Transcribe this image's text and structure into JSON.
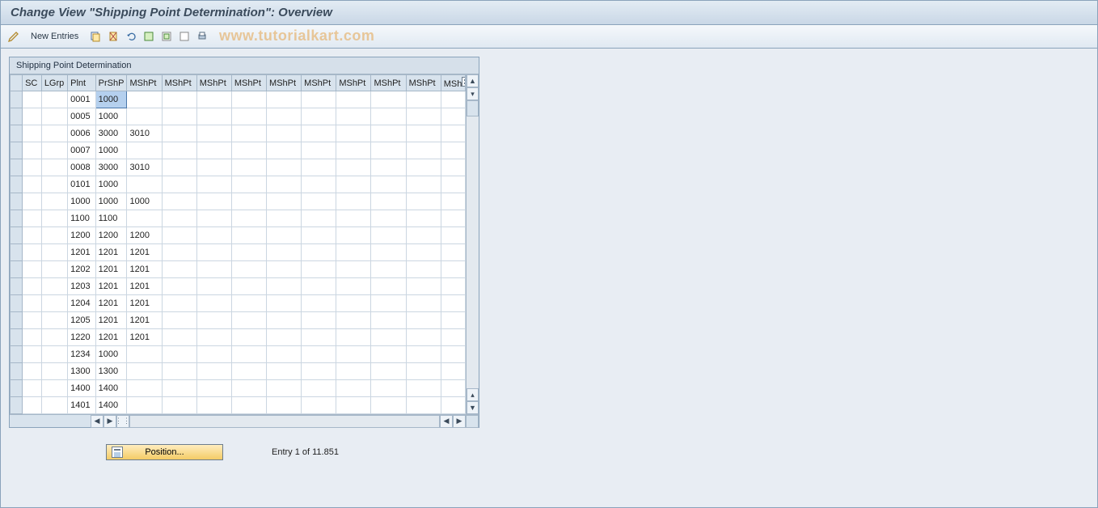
{
  "page_title": "Change View \"Shipping Point Determination\": Overview",
  "toolbar": {
    "new_entries_label": "New Entries"
  },
  "watermark": "www.tutorialkart.com",
  "panel": {
    "title": "Shipping Point Determination"
  },
  "columns": {
    "sc": "SC",
    "lgrp": "LGrp",
    "plnt": "Plnt",
    "prshp": "PrShP",
    "mshpt": "MShPt",
    "mshpt_last": "MSh"
  },
  "rows": [
    {
      "sc": "",
      "lgrp": "",
      "plnt": "0001",
      "prshp": "1000",
      "m": [
        "",
        "",
        "",
        "",
        "",
        "",
        "",
        "",
        "",
        ""
      ]
    },
    {
      "sc": "",
      "lgrp": "",
      "plnt": "0005",
      "prshp": "1000",
      "m": [
        "",
        "",
        "",
        "",
        "",
        "",
        "",
        "",
        "",
        ""
      ]
    },
    {
      "sc": "",
      "lgrp": "",
      "plnt": "0006",
      "prshp": "3000",
      "m": [
        "3010",
        "",
        "",
        "",
        "",
        "",
        "",
        "",
        "",
        ""
      ]
    },
    {
      "sc": "",
      "lgrp": "",
      "plnt": "0007",
      "prshp": "1000",
      "m": [
        "",
        "",
        "",
        "",
        "",
        "",
        "",
        "",
        "",
        ""
      ]
    },
    {
      "sc": "",
      "lgrp": "",
      "plnt": "0008",
      "prshp": "3000",
      "m": [
        "3010",
        "",
        "",
        "",
        "",
        "",
        "",
        "",
        "",
        ""
      ]
    },
    {
      "sc": "",
      "lgrp": "",
      "plnt": "0101",
      "prshp": "1000",
      "m": [
        "",
        "",
        "",
        "",
        "",
        "",
        "",
        "",
        "",
        ""
      ]
    },
    {
      "sc": "",
      "lgrp": "",
      "plnt": "1000",
      "prshp": "1000",
      "m": [
        "1000",
        "",
        "",
        "",
        "",
        "",
        "",
        "",
        "",
        ""
      ]
    },
    {
      "sc": "",
      "lgrp": "",
      "plnt": "1100",
      "prshp": "1100",
      "m": [
        "",
        "",
        "",
        "",
        "",
        "",
        "",
        "",
        "",
        ""
      ]
    },
    {
      "sc": "",
      "lgrp": "",
      "plnt": "1200",
      "prshp": "1200",
      "m": [
        "1200",
        "",
        "",
        "",
        "",
        "",
        "",
        "",
        "",
        ""
      ]
    },
    {
      "sc": "",
      "lgrp": "",
      "plnt": "1201",
      "prshp": "1201",
      "m": [
        "1201",
        "",
        "",
        "",
        "",
        "",
        "",
        "",
        "",
        ""
      ]
    },
    {
      "sc": "",
      "lgrp": "",
      "plnt": "1202",
      "prshp": "1201",
      "m": [
        "1201",
        "",
        "",
        "",
        "",
        "",
        "",
        "",
        "",
        ""
      ]
    },
    {
      "sc": "",
      "lgrp": "",
      "plnt": "1203",
      "prshp": "1201",
      "m": [
        "1201",
        "",
        "",
        "",
        "",
        "",
        "",
        "",
        "",
        ""
      ]
    },
    {
      "sc": "",
      "lgrp": "",
      "plnt": "1204",
      "prshp": "1201",
      "m": [
        "1201",
        "",
        "",
        "",
        "",
        "",
        "",
        "",
        "",
        ""
      ]
    },
    {
      "sc": "",
      "lgrp": "",
      "plnt": "1205",
      "prshp": "1201",
      "m": [
        "1201",
        "",
        "",
        "",
        "",
        "",
        "",
        "",
        "",
        ""
      ]
    },
    {
      "sc": "",
      "lgrp": "",
      "plnt": "1220",
      "prshp": "1201",
      "m": [
        "1201",
        "",
        "",
        "",
        "",
        "",
        "",
        "",
        "",
        ""
      ]
    },
    {
      "sc": "",
      "lgrp": "",
      "plnt": "1234",
      "prshp": "1000",
      "m": [
        "",
        "",
        "",
        "",
        "",
        "",
        "",
        "",
        "",
        ""
      ]
    },
    {
      "sc": "",
      "lgrp": "",
      "plnt": "1300",
      "prshp": "1300",
      "m": [
        "",
        "",
        "",
        "",
        "",
        "",
        "",
        "",
        "",
        ""
      ]
    },
    {
      "sc": "",
      "lgrp": "",
      "plnt": "1400",
      "prshp": "1400",
      "m": [
        "",
        "",
        "",
        "",
        "",
        "",
        "",
        "",
        "",
        ""
      ]
    },
    {
      "sc": "",
      "lgrp": "",
      "plnt": "1401",
      "prshp": "1400",
      "m": [
        "",
        "",
        "",
        "",
        "",
        "",
        "",
        "",
        "",
        ""
      ]
    }
  ],
  "selected_cell": {
    "row": 0,
    "col": "prshp"
  },
  "footer": {
    "position_button": "Position...",
    "entry_label": "Entry 1 of 11.851"
  },
  "colors": {
    "accent": "#b5d0ee",
    "border": "#8aa3bb",
    "header_bg": "#d8e3ed"
  }
}
